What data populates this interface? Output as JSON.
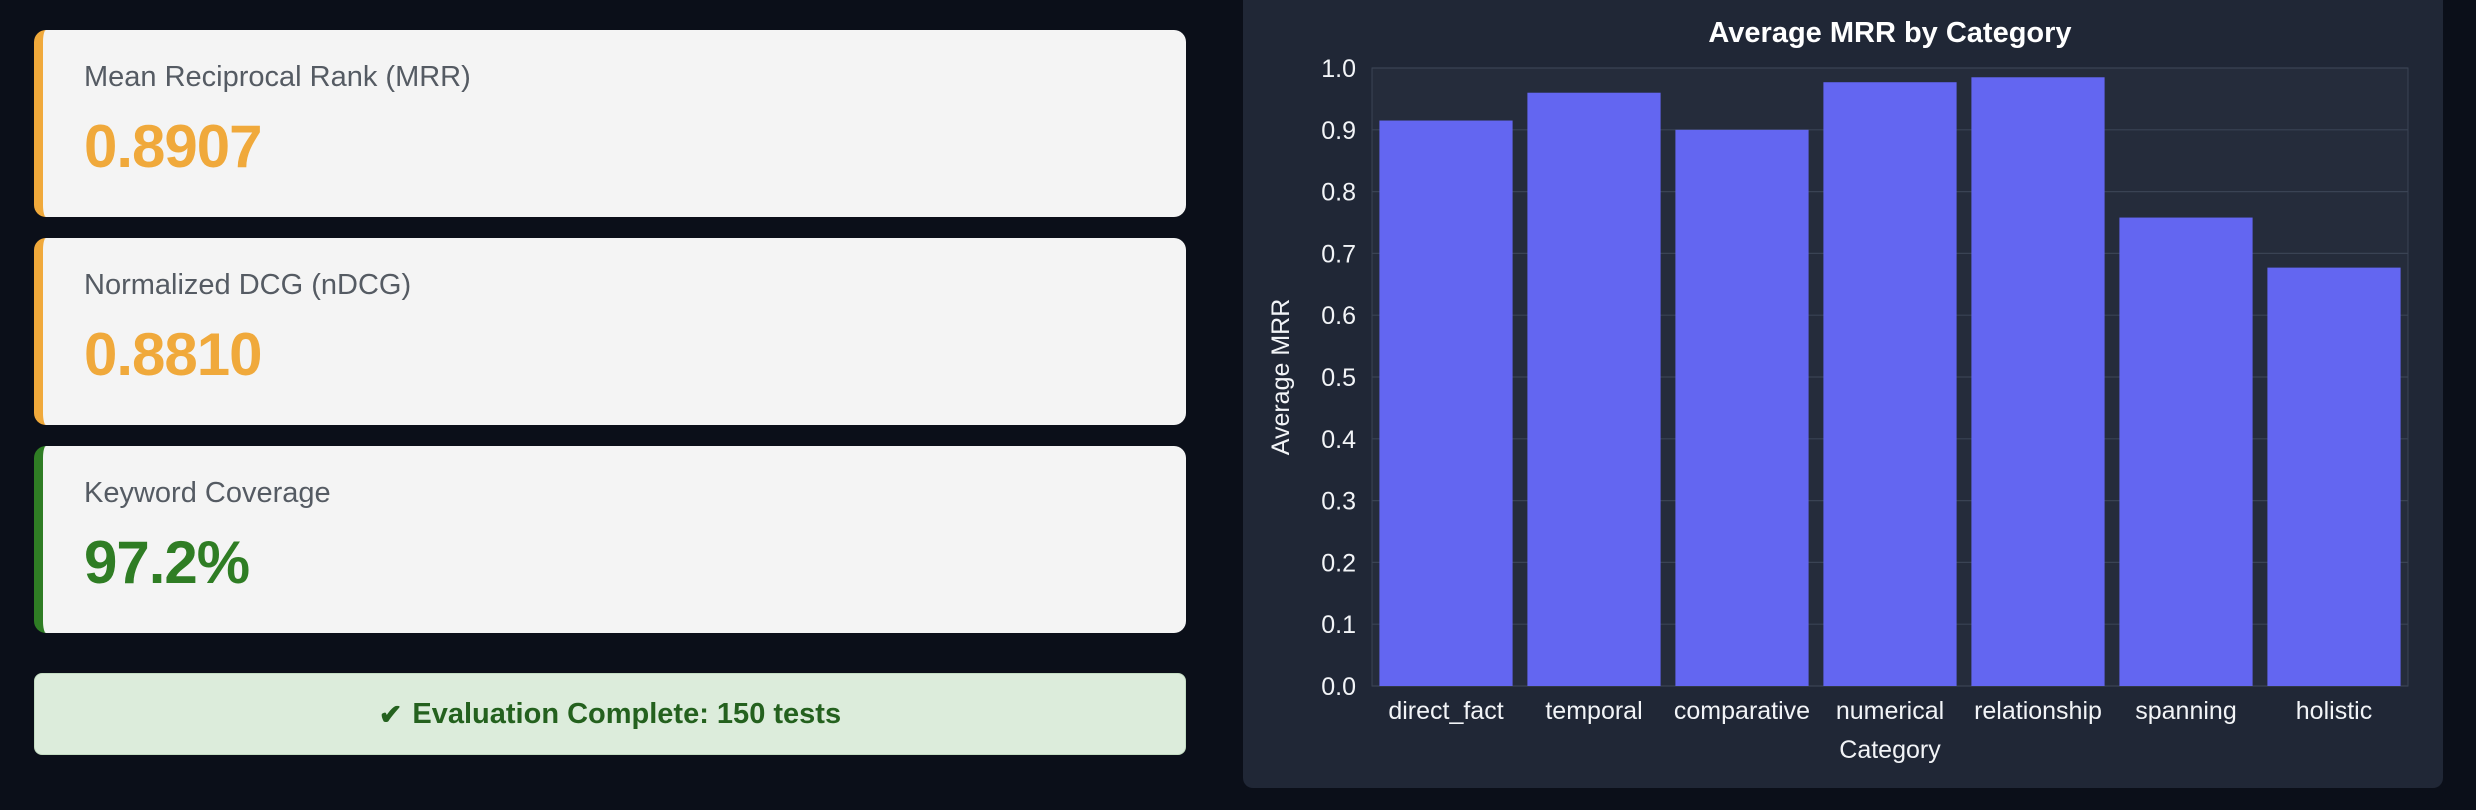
{
  "metrics": [
    {
      "label": "Mean Reciprocal Rank (MRR)",
      "value": "0.8907",
      "accent": "#f0a93b"
    },
    {
      "label": "Normalized DCG (nDCG)",
      "value": "0.8810",
      "accent": "#f0a93b"
    },
    {
      "label": "Keyword Coverage",
      "value": "97.2%",
      "accent": "#2f7d24"
    }
  ],
  "status": {
    "icon": "check-icon",
    "text": "Evaluation Complete: 150 tests",
    "color": "#24611e"
  },
  "chart_data": {
    "type": "bar",
    "title": "Average MRR by Category",
    "xlabel": "Category",
    "ylabel": "Average MRR",
    "categories": [
      "direct_fact",
      "temporal",
      "comparative",
      "numerical",
      "relationship",
      "spanning",
      "holistic"
    ],
    "values": [
      0.915,
      0.96,
      0.9,
      0.977,
      0.985,
      0.758,
      0.677
    ],
    "ylim": [
      0,
      1.0
    ],
    "yticks": [
      "0.0",
      "0.1",
      "0.2",
      "0.3",
      "0.4",
      "0.5",
      "0.6",
      "0.7",
      "0.8",
      "0.9",
      "1.0"
    ],
    "grid": true,
    "bar_color": "#6366f1"
  }
}
